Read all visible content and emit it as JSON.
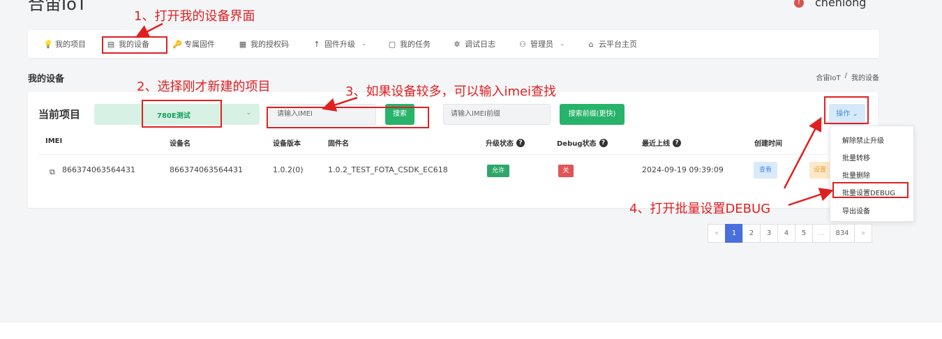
{
  "header": {
    "brand": "合宙IoT",
    "user_name": "chenlong",
    "user_badge": "!"
  },
  "nav": {
    "items": [
      {
        "icon": "💡",
        "label": "我的项目"
      },
      {
        "icon": "▤",
        "label": "我的设备"
      },
      {
        "icon": "🔑",
        "label": "专属固件"
      },
      {
        "icon": "▦",
        "label": "我的授权码"
      },
      {
        "icon": "↑",
        "label": "固件升级",
        "chevron": "⌄"
      },
      {
        "icon": "▢",
        "label": "我的任务"
      },
      {
        "icon": "✲",
        "label": "调试日志"
      },
      {
        "icon": "⚇",
        "label": "管理员",
        "chevron": "⌄"
      },
      {
        "icon": "⌂",
        "label": "云平台主页"
      }
    ]
  },
  "page": {
    "title": "我的设备",
    "breadcrumb": [
      "合宙IoT",
      "/",
      "我的设备"
    ]
  },
  "toolbar": {
    "project_label": "当前项目",
    "project_value": "780E测试",
    "project_caret": "⌄",
    "imei_placeholder": "请输入IMEI",
    "search_label": "搜索",
    "prefix_placeholder": "请输入IMEI前缀",
    "prefix_search_label": "搜索前缀(更快)",
    "ops_label": "操作 ⌄"
  },
  "table": {
    "columns": [
      "IMEI",
      "设备名",
      "设备版本",
      "固件名",
      "升级状态",
      "Debug状态",
      "最近上线",
      "创建时间"
    ],
    "rows": [
      {
        "imei": "866374063564431",
        "name": "866374063564431",
        "version": "1.0.2(0)",
        "firmware": "1.0.2_TEST_FOTA_CSDK_EC618",
        "upgrade_status": "允许",
        "debug_status": "关",
        "last_online": "2024-09-19 09:39:09",
        "view_label": "查看",
        "set_label": "设置"
      }
    ]
  },
  "dropdown": {
    "items": [
      "解除禁止升级",
      "批量转移",
      "批量删除",
      "批量设置DEBUG",
      "导出设备"
    ]
  },
  "pagination": {
    "prev": "«",
    "pages": [
      "1",
      "2",
      "3",
      "4",
      "5",
      "...",
      "834"
    ],
    "next": "»",
    "current": "1"
  },
  "annotations": {
    "step1": "1、打开我的设备界面",
    "step2": "2、选择刚才新建的项目",
    "step3": "3、如果设备较多，可以输入imei查找",
    "step4": "4、打开批量设置DEBUG"
  },
  "colors": {
    "accent_green": "#27b36a",
    "annotation_red": "#e02020",
    "pager_active": "#4a6fdc"
  }
}
